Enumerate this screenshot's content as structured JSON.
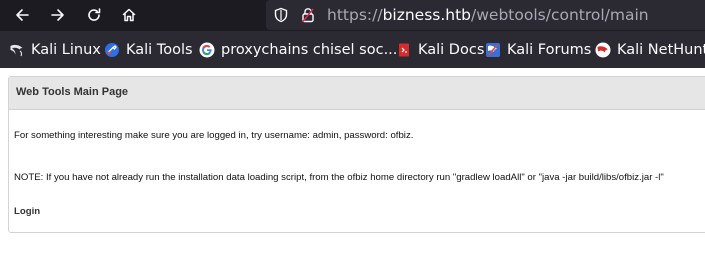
{
  "browser": {
    "url": {
      "scheme": "https://",
      "host": "bizness.htb",
      "path": "/webtools/control/main"
    },
    "bookmarks": [
      {
        "label": "Kali Linux",
        "icon": "kali-dragon-icon"
      },
      {
        "label": "Kali Tools",
        "icon": "kali-tools-icon"
      },
      {
        "label": "proxychains chisel soc...",
        "icon": "google-icon"
      },
      {
        "label": "Kali Docs",
        "icon": "kali-docs-icon"
      },
      {
        "label": "Kali Forums",
        "icon": "kali-forums-icon"
      },
      {
        "label": "Kali NetHunte",
        "icon": "kali-nethunter-icon"
      }
    ],
    "colors": {
      "chrome_dark": "#1c1b22",
      "toolbar": "#2b2a33",
      "url_dim": "#a9a9b3",
      "url_host": "#fbfbfe"
    }
  },
  "page": {
    "panel_title": "Web Tools Main Page",
    "login_hint": "For something interesting make sure you are logged in, try username: admin, password: ofbiz.",
    "note": "NOTE: If you have not already run the installation data loading script, from the ofbiz home directory run \"gradlew loadAll\" or \"java -jar build/libs/ofbiz.jar -l\"",
    "login_link": "Login"
  }
}
